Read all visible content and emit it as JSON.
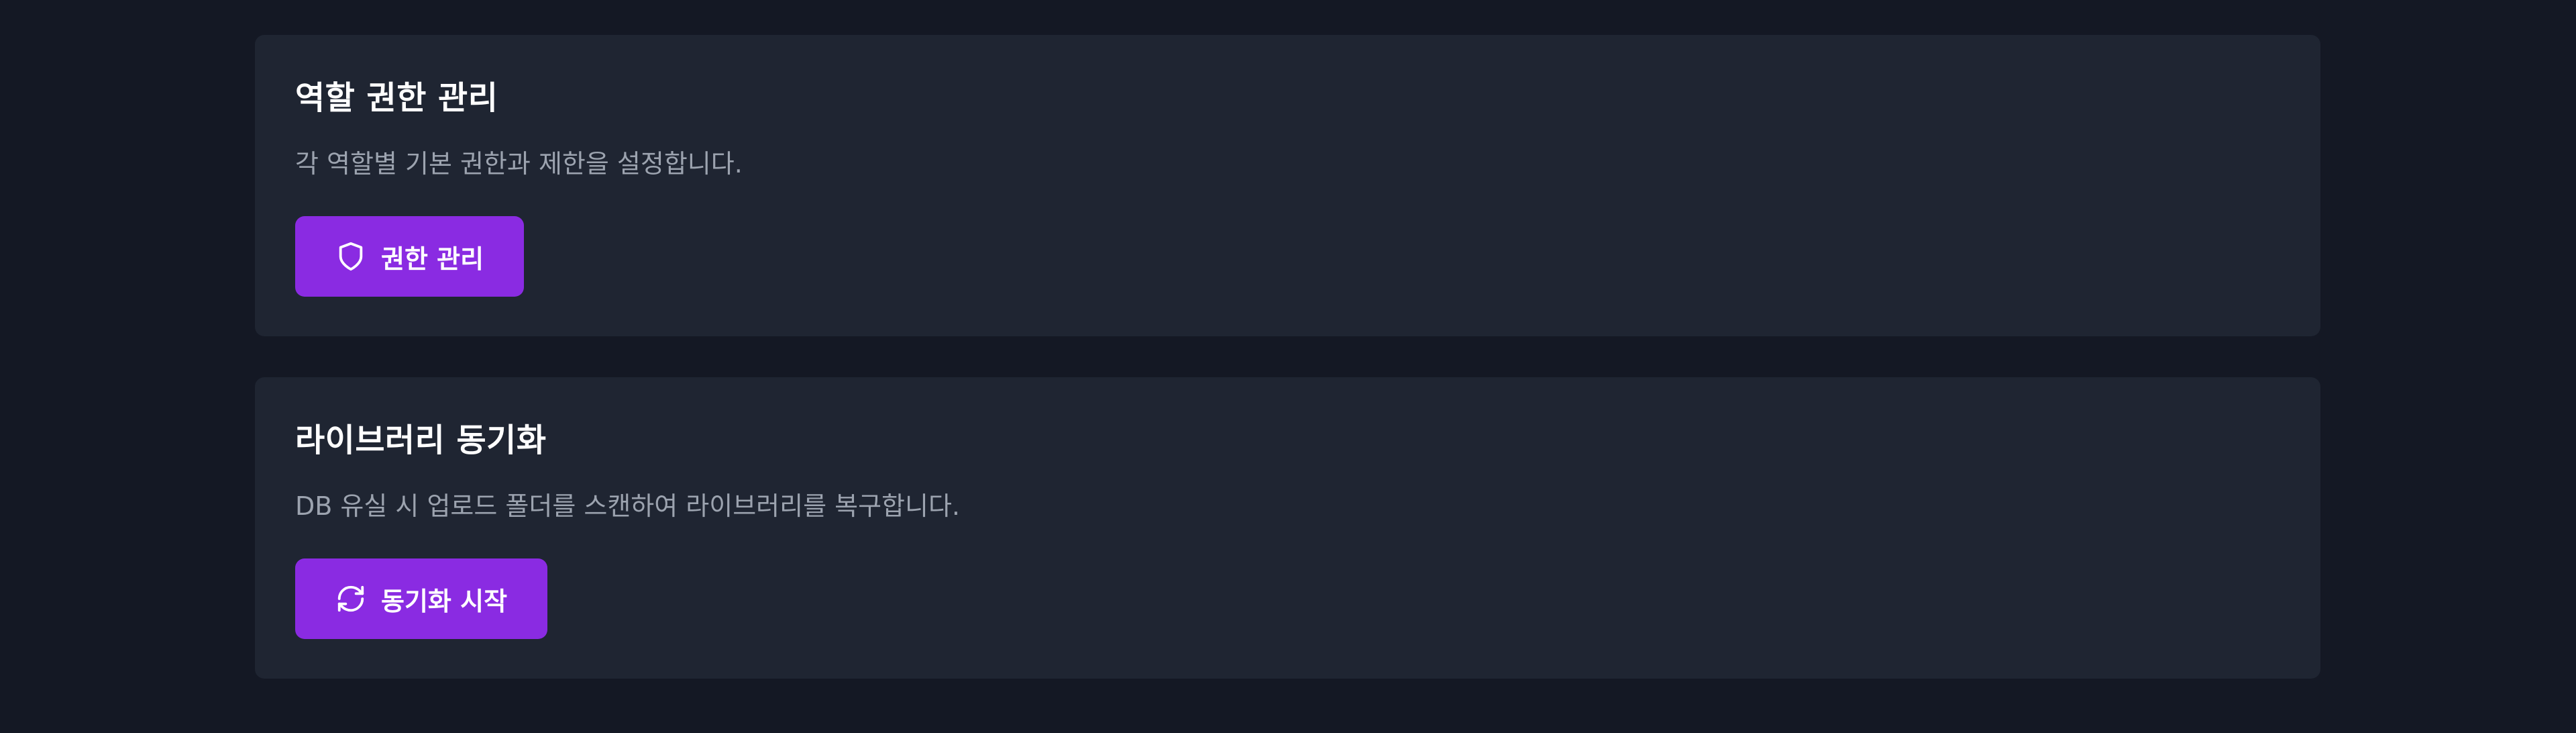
{
  "cards": [
    {
      "title": "역할 권한 관리",
      "description": "각 역할별 기본 권한과 제한을 설정합니다.",
      "button": {
        "label": "권한 관리",
        "icon": "shield-icon"
      }
    },
    {
      "title": "라이브러리 동기화",
      "description": "DB 유실 시 업로드 폴더를 스캔하여 라이브러리를 복구합니다.",
      "button": {
        "label": "동기화 시작",
        "icon": "refresh-icon"
      }
    }
  ],
  "colors": {
    "page_background": "#141824",
    "card_background": "#1f2532",
    "accent": "#8a2be2",
    "title_text": "#ffffff",
    "muted_text": "#9ca3af"
  }
}
